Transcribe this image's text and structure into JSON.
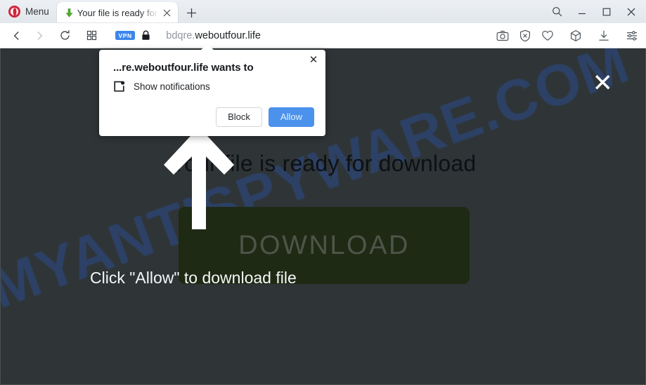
{
  "browser": {
    "menu_label": "Menu",
    "opera_logo_icon": "opera-logo-icon",
    "tab": {
      "favicon": "green-download-arrow-icon",
      "title": "Your file is ready for",
      "close_icon": "close-icon"
    },
    "new_tab_icon": "plus-icon",
    "window_controls": {
      "search_icon": "search-icon",
      "minimize_icon": "minimize-icon",
      "maximize_icon": "maximize-icon",
      "close_icon": "close-icon"
    },
    "nav": {
      "back_icon": "chevron-left-icon",
      "forward_icon": "chevron-right-icon",
      "reload_icon": "reload-icon",
      "tiles_icon": "grid-tiles-icon"
    },
    "address": {
      "vpn_badge": "VPN",
      "lock_icon": "lock-icon",
      "url_prefix": "bdqre.",
      "url_domain": "weboutfour.life"
    },
    "toolbar_icons": [
      "camera-snapshot-icon",
      "ad-blocker-shield-icon",
      "heart-favorite-icon",
      "cube-extensions-icon",
      "download-icon",
      "easy-setup-sliders-icon"
    ]
  },
  "page": {
    "watermark": "MYANTISPYWARE.COM",
    "close_icon": "close-icon",
    "headline": "Your file is ready for download",
    "download_button_label": "DOWNLOAD",
    "hint": "Click \"Allow\" to download file",
    "arrow_annotation_icon": "up-arrow-annotation-icon"
  },
  "notification_popup": {
    "title": "...re.weboutfour.life wants to",
    "permission_icon": "notifications-bell-icon",
    "permission_label": "Show notifications",
    "close_icon": "close-icon",
    "block_label": "Block",
    "allow_label": "Allow"
  },
  "colors": {
    "accent_blue": "#4b92ec",
    "opera_red": "#d0253a",
    "page_bg": "#2f3436",
    "download_button": "#1e2a14",
    "watermark_blue": "#2b4a82"
  }
}
